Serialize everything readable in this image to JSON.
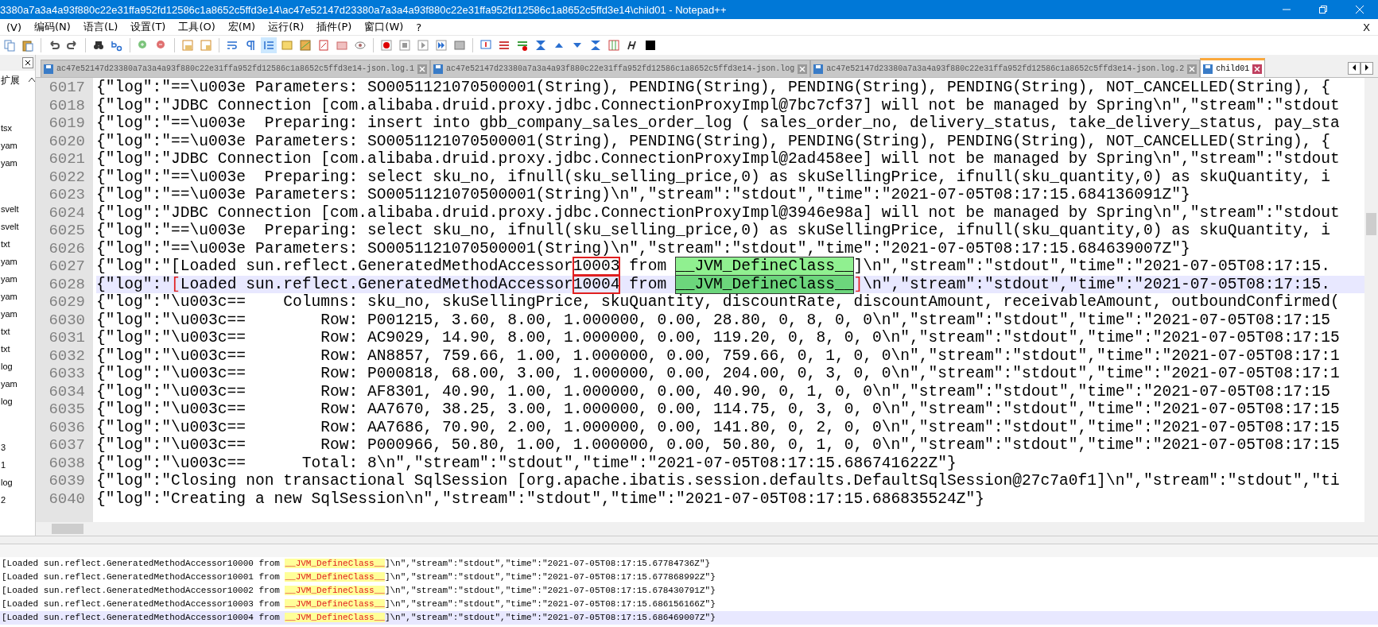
{
  "window": {
    "title": "3380a7a3a4a93f880c22e31ffa952fd12586c1a8652c5ffd3e14\\ac47e52147d23380a7a3a4a93f880c22e31ffa952fd12586c1a8652c5ffd3e14\\child01 - Notepad++"
  },
  "menu": {
    "items": [
      "(V)",
      "编码(N)",
      "语言(L)",
      "设置(T)",
      "工具(O)",
      "宏(M)",
      "运行(R)",
      "插件(P)",
      "窗口(W)",
      "?"
    ],
    "close": "X"
  },
  "sidebar": {
    "title": "扩展",
    "groups": [
      [
        "tsx",
        "yam",
        "yam"
      ],
      [
        "svelt",
        "svelt",
        "txt",
        "yam",
        "yam",
        "yam",
        "yam",
        "txt",
        "txt",
        "log",
        "yam",
        "log"
      ],
      [
        "3",
        "1",
        "log",
        "2"
      ]
    ]
  },
  "tabs": [
    {
      "label": "ac47e52147d23380a7a3a4a93f880c22e31ffa952fd12586c1a8652c5ffd3e14-json.log.1",
      "selected": false
    },
    {
      "label": "ac47e52147d23380a7a3a4a93f880c22e31ffa952fd12586c1a8652c5ffd3e14-json.log",
      "selected": false
    },
    {
      "label": "ac47e52147d23380a7a3a4a93f880c22e31ffa952fd12586c1a8652c5ffd3e14-json.log.2",
      "selected": false
    },
    {
      "label": "child01",
      "selected": true
    }
  ],
  "editor": {
    "lines": [
      {
        "num": "6017",
        "selected": false,
        "segments": [
          {
            "kind": "plain",
            "t": "{\"log\":\"==\\u003e Parameters: SO0051121070500001(String), PENDING(String), PENDING(String), PENDING(String), NOT_CANCELLED(String), {"
          }
        ]
      },
      {
        "num": "6018",
        "selected": false,
        "segments": [
          {
            "kind": "plain",
            "t": "{\"log\":\"JDBC Connection [com.alibaba.druid.proxy.jdbc.ConnectionProxyImpl@7bc7cf37] will not be managed by Spring\\n\",\"stream\":\"stdout"
          }
        ]
      },
      {
        "num": "6019",
        "selected": false,
        "segments": [
          {
            "kind": "plain",
            "t": "{\"log\":\"==\\u003e  Preparing: insert into gbb_company_sales_order_log ( sales_order_no, delivery_status, take_delivery_status, pay_sta"
          }
        ]
      },
      {
        "num": "6020",
        "selected": false,
        "segments": [
          {
            "kind": "plain",
            "t": "{\"log\":\"==\\u003e Parameters: SO0051121070500001(String), PENDING(String), PENDING(String), PENDING(String), NOT_CANCELLED(String), {"
          }
        ]
      },
      {
        "num": "6021",
        "selected": false,
        "segments": [
          {
            "kind": "plain",
            "t": "{\"log\":\"JDBC Connection [com.alibaba.druid.proxy.jdbc.ConnectionProxyImpl@2ad458ee] will not be managed by Spring\\n\",\"stream\":\"stdout"
          }
        ]
      },
      {
        "num": "6022",
        "selected": false,
        "segments": [
          {
            "kind": "plain",
            "t": "{\"log\":\"==\\u003e  Preparing: select sku_no, ifnull(sku_selling_price,0) as skuSellingPrice, ifnull(sku_quantity,0) as skuQuantity, i"
          }
        ]
      },
      {
        "num": "6023",
        "selected": false,
        "segments": [
          {
            "kind": "plain",
            "t": "{\"log\":\"==\\u003e Parameters: SO0051121070500001(String)\\n\",\"stream\":\"stdout\",\"time\":\"2021-07-05T08:17:15.684136091Z\"}"
          }
        ]
      },
      {
        "num": "6024",
        "selected": false,
        "segments": [
          {
            "kind": "plain",
            "t": "{\"log\":\"JDBC Connection [com.alibaba.druid.proxy.jdbc.ConnectionProxyImpl@3946e98a] will not be managed by Spring\\n\",\"stream\":\"stdout"
          }
        ]
      },
      {
        "num": "6025",
        "selected": false,
        "segments": [
          {
            "kind": "plain",
            "t": "{\"log\":\"==\\u003e  Preparing: select sku_no, ifnull(sku_selling_price,0) as skuSellingPrice, ifnull(sku_quantity,0) as skuQuantity, i"
          }
        ]
      },
      {
        "num": "6026",
        "selected": false,
        "segments": [
          {
            "kind": "plain",
            "t": "{\"log\":\"==\\u003e Parameters: SO0051121070500001(String)\\n\",\"stream\":\"stdout\",\"time\":\"2021-07-05T08:17:15.684639007Z\"}"
          }
        ]
      },
      {
        "num": "6027",
        "selected": false,
        "segments": [
          {
            "kind": "plain",
            "t": "{\"log\":\"[Loaded sun.reflect.GeneratedMethodAccessor"
          },
          {
            "kind": "boxed",
            "t": "10003"
          },
          {
            "kind": "plain",
            "t": " from "
          },
          {
            "kind": "match",
            "t": "__JVM_DefineClass__"
          },
          {
            "kind": "plain",
            "t": "]\\n\",\"stream\":\"stdout\",\"time\":\"2021-07-05T08:17:15."
          }
        ]
      },
      {
        "num": "6028",
        "selected": true,
        "segments": [
          {
            "kind": "plain",
            "t": "{\"log\":\""
          },
          {
            "kind": "brace",
            "t": "["
          },
          {
            "kind": "plain",
            "t": "Loaded sun.reflect.GeneratedMethodAccessor"
          },
          {
            "kind": "boxed",
            "t": "10004"
          },
          {
            "kind": "plain",
            "t": " from "
          },
          {
            "kind": "match",
            "t": "__JVM_DefineClass__"
          },
          {
            "kind": "brace",
            "t": "]"
          },
          {
            "kind": "plain",
            "t": "\\n\",\"stream\":\"stdout\",\"time\":\"2021-07-05T08:17:15."
          }
        ]
      },
      {
        "num": "6029",
        "selected": false,
        "segments": [
          {
            "kind": "plain",
            "t": "{\"log\":\"\\u003c==    Columns: sku_no, skuSellingPrice, skuQuantity, discountRate, discountAmount, receivableAmount, outboundConfirmed("
          }
        ]
      },
      {
        "num": "6030",
        "selected": false,
        "segments": [
          {
            "kind": "plain",
            "t": "{\"log\":\"\\u003c==        Row: P001215, 3.60, 8.00, 1.000000, 0.00, 28.80, 0, 8, 0, 0\\n\",\"stream\":\"stdout\",\"time\":\"2021-07-05T08:17:15"
          }
        ]
      },
      {
        "num": "6031",
        "selected": false,
        "segments": [
          {
            "kind": "plain",
            "t": "{\"log\":\"\\u003c==        Row: AC9029, 14.90, 8.00, 1.000000, 0.00, 119.20, 0, 8, 0, 0\\n\",\"stream\":\"stdout\",\"time\":\"2021-07-05T08:17:15"
          }
        ]
      },
      {
        "num": "6032",
        "selected": false,
        "segments": [
          {
            "kind": "plain",
            "t": "{\"log\":\"\\u003c==        Row: AN8857, 759.66, 1.00, 1.000000, 0.00, 759.66, 0, 1, 0, 0\\n\",\"stream\":\"stdout\",\"time\":\"2021-07-05T08:17:1"
          }
        ]
      },
      {
        "num": "6033",
        "selected": false,
        "segments": [
          {
            "kind": "plain",
            "t": "{\"log\":\"\\u003c==        Row: P000818, 68.00, 3.00, 1.000000, 0.00, 204.00, 0, 3, 0, 0\\n\",\"stream\":\"stdout\",\"time\":\"2021-07-05T08:17:1"
          }
        ]
      },
      {
        "num": "6034",
        "selected": false,
        "segments": [
          {
            "kind": "plain",
            "t": "{\"log\":\"\\u003c==        Row: AF8301, 40.90, 1.00, 1.000000, 0.00, 40.90, 0, 1, 0, 0\\n\",\"stream\":\"stdout\",\"time\":\"2021-07-05T08:17:15"
          }
        ]
      },
      {
        "num": "6035",
        "selected": false,
        "segments": [
          {
            "kind": "plain",
            "t": "{\"log\":\"\\u003c==        Row: AA7670, 38.25, 3.00, 1.000000, 0.00, 114.75, 0, 3, 0, 0\\n\",\"stream\":\"stdout\",\"time\":\"2021-07-05T08:17:15"
          }
        ]
      },
      {
        "num": "6036",
        "selected": false,
        "segments": [
          {
            "kind": "plain",
            "t": "{\"log\":\"\\u003c==        Row: AA7686, 70.90, 2.00, 1.000000, 0.00, 141.80, 0, 2, 0, 0\\n\",\"stream\":\"stdout\",\"time\":\"2021-07-05T08:17:15"
          }
        ]
      },
      {
        "num": "6037",
        "selected": false,
        "segments": [
          {
            "kind": "plain",
            "t": "{\"log\":\"\\u003c==        Row: P000966, 50.80, 1.00, 1.000000, 0.00, 50.80, 0, 1, 0, 0\\n\",\"stream\":\"stdout\",\"time\":\"2021-07-05T08:17:15"
          }
        ]
      },
      {
        "num": "6038",
        "selected": false,
        "segments": [
          {
            "kind": "plain",
            "t": "{\"log\":\"\\u003c==      Total: 8\\n\",\"stream\":\"stdout\",\"time\":\"2021-07-05T08:17:15.686741622Z\"}"
          }
        ]
      },
      {
        "num": "6039",
        "selected": false,
        "segments": [
          {
            "kind": "plain",
            "t": "{\"log\":\"Closing non transactional SqlSession [org.apache.ibatis.session.defaults.DefaultSqlSession@27c7a0f1]\\n\",\"stream\":\"stdout\",\"ti"
          }
        ]
      },
      {
        "num": "6040",
        "selected": false,
        "segments": [
          {
            "kind": "plain",
            "t": "{\"log\":\"Creating a new SqlSession\\n\",\"stream\":\"stdout\",\"time\":\"2021-07-05T08:17:15.686835524Z\"}"
          }
        ]
      }
    ]
  },
  "results": {
    "lines": [
      {
        "selected": false,
        "segments": [
          {
            "kind": "plain",
            "t": "[Loaded sun.reflect.GeneratedMethodAccessor10000 from "
          },
          {
            "kind": "match",
            "t": "__JVM_DefineClass__"
          },
          {
            "kind": "plain",
            "t": "]\\n\",\"stream\":\"stdout\",\"time\":\"2021-07-05T08:17:15.67784736Z\"}"
          }
        ]
      },
      {
        "selected": false,
        "segments": [
          {
            "kind": "plain",
            "t": "[Loaded sun.reflect.GeneratedMethodAccessor10001 from "
          },
          {
            "kind": "match",
            "t": "__JVM_DefineClass__"
          },
          {
            "kind": "plain",
            "t": "]\\n\",\"stream\":\"stdout\",\"time\":\"2021-07-05T08:17:15.677868992Z\"}"
          }
        ]
      },
      {
        "selected": false,
        "segments": [
          {
            "kind": "plain",
            "t": "[Loaded sun.reflect.GeneratedMethodAccessor10002 from "
          },
          {
            "kind": "match",
            "t": "__JVM_DefineClass__"
          },
          {
            "kind": "plain",
            "t": "]\\n\",\"stream\":\"stdout\",\"time\":\"2021-07-05T08:17:15.678430791Z\"}"
          }
        ]
      },
      {
        "selected": false,
        "segments": [
          {
            "kind": "plain",
            "t": "[Loaded sun.reflect.GeneratedMethodAccessor10003 from "
          },
          {
            "kind": "match",
            "t": "__JVM_DefineClass__"
          },
          {
            "kind": "plain",
            "t": "]\\n\",\"stream\":\"stdout\",\"time\":\"2021-07-05T08:17:15.686156166Z\"}"
          }
        ]
      },
      {
        "selected": true,
        "segments": [
          {
            "kind": "plain",
            "t": "[Loaded sun.reflect.GeneratedMethodAccessor10004 from "
          },
          {
            "kind": "match",
            "t": "__JVM_DefineClass__"
          },
          {
            "kind": "plain",
            "t": "]\\n\",\"stream\":\"stdout\",\"time\":\"2021-07-05T08:17:15.686469007Z\"}"
          }
        ]
      }
    ]
  }
}
